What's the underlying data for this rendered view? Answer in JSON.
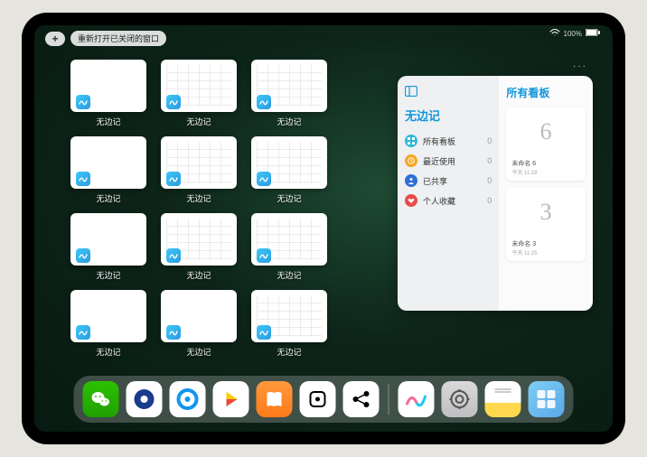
{
  "status": {
    "battery": "100%"
  },
  "topbar": {
    "plus": "+",
    "reopen_label": "重新打开已关闭的窗口"
  },
  "app_name": "无边记",
  "windows": [
    {
      "label": "无边记",
      "variant": "blank"
    },
    {
      "label": "无边记",
      "variant": "cal"
    },
    {
      "label": "无边记",
      "variant": "cal"
    },
    {
      "label": "无边记",
      "variant": "blank"
    },
    {
      "label": "无边记",
      "variant": "cal"
    },
    {
      "label": "无边记",
      "variant": "cal"
    },
    {
      "label": "无边记",
      "variant": "blank"
    },
    {
      "label": "无边记",
      "variant": "cal"
    },
    {
      "label": "无边记",
      "variant": "cal"
    },
    {
      "label": "无边记",
      "variant": "blank"
    },
    {
      "label": "无边记",
      "variant": "blank"
    },
    {
      "label": "无边记",
      "variant": "cal"
    }
  ],
  "side_more": "···",
  "panel": {
    "left_title": "无边记",
    "items": [
      {
        "icon": "grid",
        "color": "#2bbad9",
        "label": "所有看板",
        "count": "0"
      },
      {
        "icon": "clock",
        "color": "#f6a623",
        "label": "最近使用",
        "count": "0"
      },
      {
        "icon": "person",
        "color": "#2c6fd6",
        "label": "已共享",
        "count": "0"
      },
      {
        "icon": "heart",
        "color": "#e94b4b",
        "label": "个人收藏",
        "count": "0"
      }
    ],
    "right_title": "所有看板",
    "boards": [
      {
        "doodle": "6",
        "name": "未命名 6",
        "time": "今天 11:28"
      },
      {
        "doodle": "3",
        "name": "未命名 3",
        "time": "今天 11:25"
      }
    ]
  },
  "dock": [
    {
      "name": "wechat",
      "cls": "di-wechat"
    },
    {
      "name": "browser",
      "cls": "di-round-blue"
    },
    {
      "name": "qqbrowser",
      "cls": "di-q"
    },
    {
      "name": "video",
      "cls": "di-play"
    },
    {
      "name": "books",
      "cls": "di-books"
    },
    {
      "name": "game",
      "cls": "di-dice"
    },
    {
      "name": "connect",
      "cls": "di-dots"
    },
    {
      "name": "sep"
    },
    {
      "name": "freeform",
      "cls": "di-freeform"
    },
    {
      "name": "settings",
      "cls": "di-settings"
    },
    {
      "name": "notes",
      "cls": "di-notes"
    },
    {
      "name": "app-library",
      "cls": "di-grid"
    }
  ]
}
